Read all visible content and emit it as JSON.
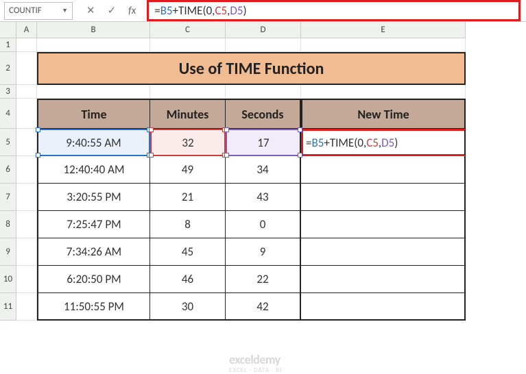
{
  "name_box": "COUNTIF",
  "formula_bar": "=B5+TIME(0,C5,D5)",
  "title": "Use of TIME Function",
  "headers": {
    "time": "Time",
    "minutes": "Minutes",
    "seconds": "Seconds",
    "newtime": "New Time"
  },
  "col_labels": {
    "A": "A",
    "B": "B",
    "C": "C",
    "D": "D",
    "E": "E"
  },
  "row_labels": [
    "1",
    "2",
    "3",
    "4",
    "5",
    "6",
    "7",
    "8",
    "9",
    "10",
    "11"
  ],
  "formula_cell": {
    "eq": "=",
    "b5": "B5",
    "plus": "+TIME(0,",
    "c5": "C5",
    "comma": ",",
    "d5": "D5",
    "close": ")"
  },
  "rows": [
    {
      "time": "9:40:55 AM",
      "min": "32",
      "sec": "17"
    },
    {
      "time": "12:40:40 AM",
      "min": "49",
      "sec": "34"
    },
    {
      "time": "3:20:55 PM",
      "min": "21",
      "sec": "43"
    },
    {
      "time": "7:25:47 PM",
      "min": "8",
      "sec": "0"
    },
    {
      "time": "7:34:26 AM",
      "min": "45",
      "sec": "9"
    },
    {
      "time": "6:20:50 PM",
      "min": "46",
      "sec": "22"
    },
    {
      "time": "11:50:55 PM",
      "min": "30",
      "sec": "42"
    }
  ],
  "watermark": {
    "line1": "exceldemy",
    "line2": "EXCEL · DATA · BI"
  },
  "icons": {
    "cancel": "✕",
    "enter": "✓",
    "fx": "fx",
    "dropdown": "▼"
  }
}
